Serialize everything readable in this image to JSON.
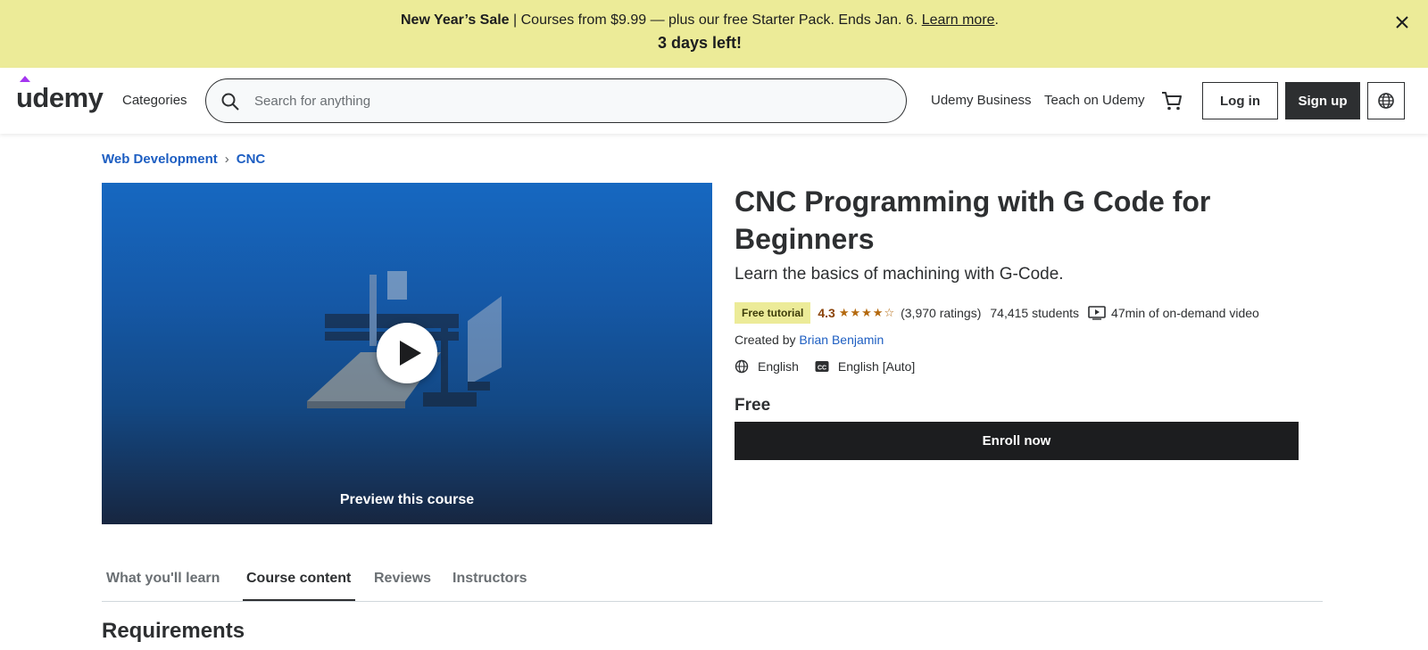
{
  "banner": {
    "sale_title": "New Year’s Sale",
    "message": " | Courses from $9.99 — plus our free Starter Pack. Ends Jan. 6. ",
    "link": "Learn more",
    "period": ".",
    "countdown": "3 days left!",
    "close_icon": "close-icon"
  },
  "header": {
    "logo": "udemy",
    "categories": "Categories",
    "search_placeholder": "Search for anything",
    "udemy_business": "Udemy Business",
    "teach": "Teach on Udemy",
    "login": "Log in",
    "signup": "Sign up",
    "icons": [
      "search-icon",
      "cart-icon",
      "globe-icon"
    ]
  },
  "breadcrumb": {
    "items": [
      "Web Development",
      "CNC"
    ],
    "separator": "›"
  },
  "preview": {
    "label": "Preview this course"
  },
  "course": {
    "title": "CNC Programming with G Code for Beginners",
    "subtitle": "Learn the basics of machining with G-Code.",
    "badge": "Free tutorial",
    "rating": "4.3",
    "stars": "★★★★☆",
    "ratings_count": "(3,970 ratings)",
    "students": "74,415 students",
    "video": "47min of on-demand video",
    "created_by_label": "Created by",
    "author": "Brian Benjamin",
    "language": "English",
    "captions": "English [Auto]",
    "price": "Free",
    "enroll": "Enroll now"
  },
  "tabs": [
    "What you'll learn",
    "Course content",
    "Reviews",
    "Instructors"
  ],
  "active_tab": "Course content",
  "section_heading": "Requirements",
  "colors": {
    "banner_bg": "#eceb98",
    "link_blue": "#1d5ec2",
    "dark": "#2d2f31",
    "rating_orange": "#b4690e"
  }
}
